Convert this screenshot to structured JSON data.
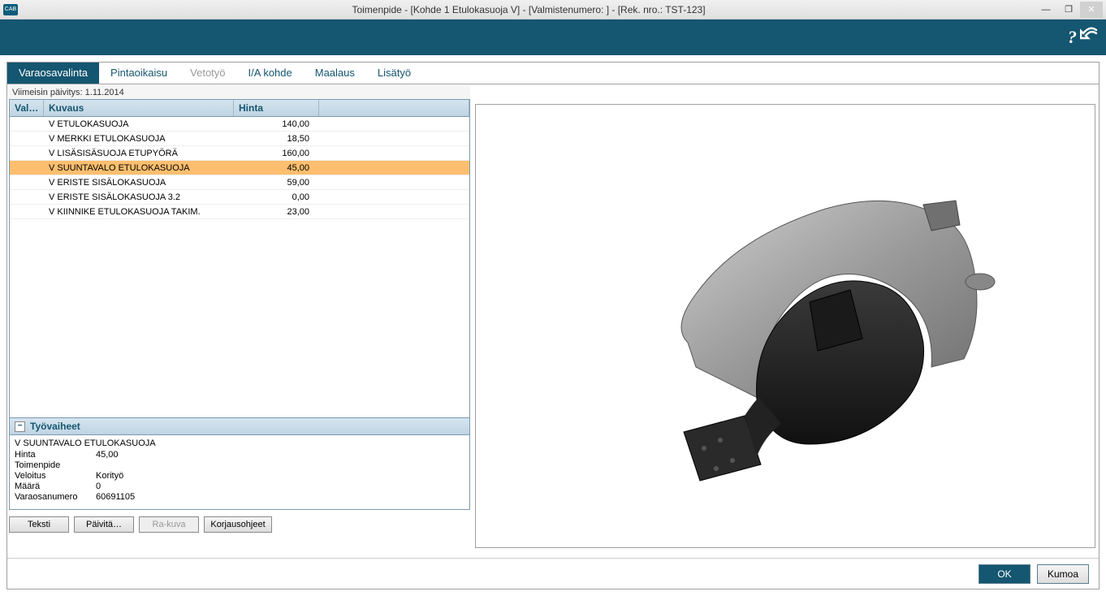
{
  "window": {
    "title": "Toimenpide - [Kohde 1 Etulokasuoja V] - [Valmistenumero: ] - [Rek. nro.: TST-123]",
    "app_icon_text": "CAB"
  },
  "tabs": [
    {
      "label": "Varaosavalinta",
      "state": "active"
    },
    {
      "label": "Pintaoikaisu",
      "state": "normal"
    },
    {
      "label": "Vetotyö",
      "state": "disabled"
    },
    {
      "label": "I/A kohde",
      "state": "normal"
    },
    {
      "label": "Maalaus",
      "state": "normal"
    },
    {
      "label": "Lisätyö",
      "state": "normal"
    }
  ],
  "update_line": "Viimeisin päivitys: 1.11.2014",
  "columns": {
    "val": "Val…",
    "desc": "Kuvaus",
    "price": "Hinta"
  },
  "rows": [
    {
      "desc": "V ETULOKASUOJA",
      "price": "140,00",
      "selected": false
    },
    {
      "desc": "V MERKKI ETULOKASUOJA",
      "price": "18,50",
      "selected": false
    },
    {
      "desc": "V LISÄSISÄSUOJA ETUPYÖRÄ",
      "price": "160,00",
      "selected": false
    },
    {
      "desc": "V SUUNTAVALO ETULOKASUOJA",
      "price": "45,00",
      "selected": true
    },
    {
      "desc": "V ERISTE SISÄLOKASUOJA",
      "price": "59,00",
      "selected": false
    },
    {
      "desc": "V ERISTE SISÄLOKASUOJA 3.2",
      "price": "0,00",
      "selected": false
    },
    {
      "desc": "V KIINNIKE ETULOKASUOJA TAKIM.",
      "price": "23,00",
      "selected": false
    }
  ],
  "details": {
    "header": "Työvaiheet",
    "title": "V SUUNTAVALO ETULOKASUOJA",
    "lines": [
      {
        "label": "Hinta",
        "value": "45,00"
      },
      {
        "label": "Toimenpide",
        "value": ""
      },
      {
        "label": "Veloitus",
        "value": "Korityö"
      },
      {
        "label": "Määrä",
        "value": "0"
      },
      {
        "label": "Varaosanumero",
        "value": "60691105"
      }
    ]
  },
  "buttons": {
    "teksti": "Teksti",
    "paivita": "Päivitä…",
    "rakuva": "Ra-kuva",
    "korjausohjeet": "Korjausohjeet"
  },
  "footer": {
    "ok": "OK",
    "cancel": "Kumoa"
  }
}
